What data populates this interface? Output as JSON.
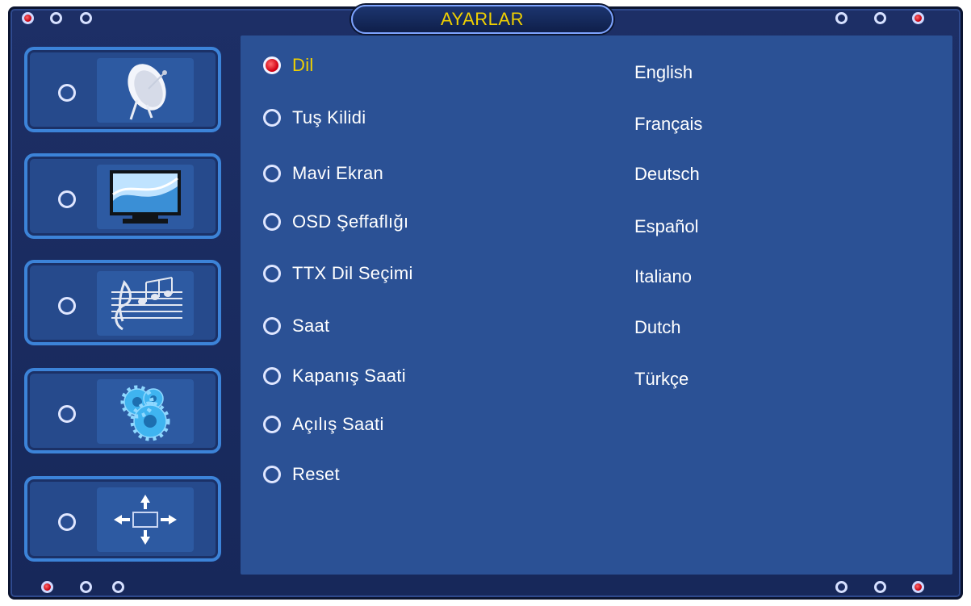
{
  "header": {
    "title": "AYARLAR"
  },
  "sidebar": {
    "items": [
      {
        "icon": "satellite-dish-icon"
      },
      {
        "icon": "tv-monitor-icon"
      },
      {
        "icon": "music-notes-icon"
      },
      {
        "icon": "gears-icon"
      },
      {
        "icon": "arrows-position-icon"
      }
    ]
  },
  "menu": {
    "selected": "Dil",
    "items": [
      {
        "label": "Dil"
      },
      {
        "label": "Tuş Kilidi"
      },
      {
        "label": "Mavi Ekran"
      },
      {
        "label": "OSD Şeffaflığı"
      },
      {
        "label": "TTX Dil Seçimi"
      },
      {
        "label": "Saat"
      },
      {
        "label": "Kapanış Saati"
      },
      {
        "label": "Açılış Saati"
      },
      {
        "label": "Reset"
      }
    ]
  },
  "options": {
    "items": [
      {
        "label": "English"
      },
      {
        "label": "Français"
      },
      {
        "label": "Deutsch"
      },
      {
        "label": "Español"
      },
      {
        "label": "Italiano"
      },
      {
        "label": "Dutch"
      },
      {
        "label": "Türkçe"
      }
    ]
  },
  "colors": {
    "background": "#1d2f66",
    "panel": "#2b5195",
    "accent": "#f0d000",
    "sidebar_border": "#3c83d8",
    "active_radio": "#d10012"
  }
}
